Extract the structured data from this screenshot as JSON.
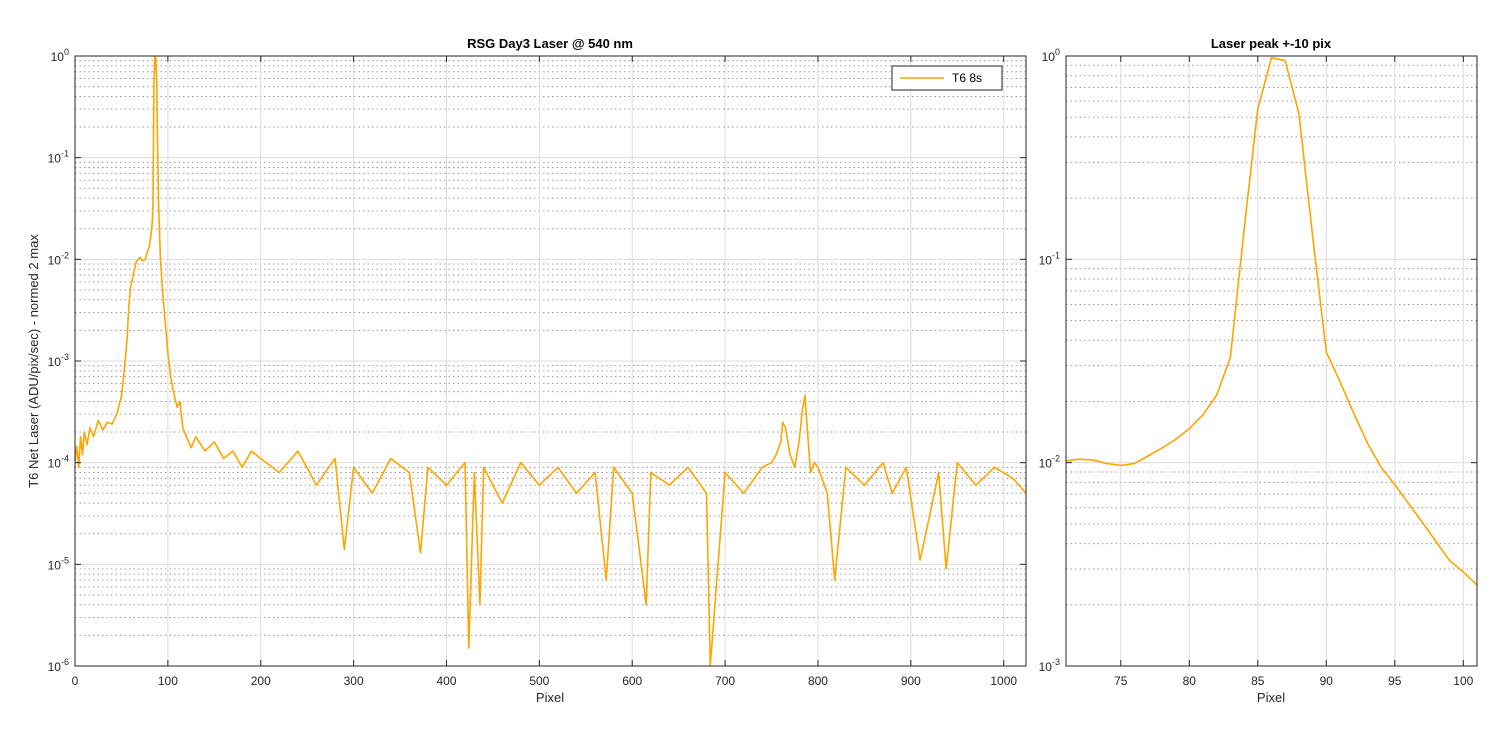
{
  "colors": {
    "series": "#ffa500",
    "grid_major": "#dcdcdc",
    "grid_minor": "#9a9a9a",
    "axis": "#262626",
    "background": "#ffffff"
  },
  "chart_data": [
    {
      "type": "line",
      "title": "RSG  Day3 Laser @ 540 nm",
      "xlabel": "Pixel",
      "ylabel": "T6 Net Laser (ADU/pix/sec) - normed 2 max",
      "xlim": [
        0,
        1024
      ],
      "ylim": [
        1e-06,
        1
      ],
      "yscale": "log",
      "grid": true,
      "legend_position": "top-right",
      "xticks": [
        0,
        100,
        200,
        300,
        400,
        500,
        600,
        700,
        800,
        900,
        1000
      ],
      "xtick_labels": [
        "0",
        "100",
        "200",
        "300",
        "400",
        "500",
        "600",
        "700",
        "800",
        "900",
        "1000"
      ],
      "yticks": [
        1e-06,
        1e-05,
        0.0001,
        0.001,
        0.01,
        0.1,
        1
      ],
      "ytick_labels": [
        {
          "base": "10",
          "exp": "-6"
        },
        {
          "base": "10",
          "exp": "-5"
        },
        {
          "base": "10",
          "exp": "-4"
        },
        {
          "base": "10",
          "exp": "-3"
        },
        {
          "base": "10",
          "exp": "-2"
        },
        {
          "base": "10",
          "exp": "-1"
        },
        {
          "base": "10",
          "exp": "0"
        }
      ],
      "series": [
        {
          "name": "T6 8s",
          "x": [
            0,
            2,
            4,
            6,
            8,
            10,
            13,
            16,
            20,
            25,
            30,
            35,
            40,
            45,
            50,
            53,
            56,
            58,
            60,
            62,
            64,
            66,
            68,
            70,
            72,
            74,
            76,
            78,
            80,
            82,
            83,
            84,
            85,
            86,
            87,
            88,
            89,
            90,
            92,
            95,
            98,
            100,
            103,
            106,
            110,
            113,
            116,
            120,
            125,
            130,
            140,
            150,
            160,
            170,
            180,
            190,
            200,
            220,
            240,
            260,
            280,
            290,
            300,
            320,
            340,
            360,
            372,
            380,
            400,
            420,
            424,
            430,
            436,
            440,
            460,
            480,
            500,
            520,
            540,
            560,
            572,
            580,
            600,
            615,
            620,
            640,
            660,
            680,
            684,
            700,
            720,
            740,
            750,
            755,
            760,
            762,
            765,
            770,
            775,
            780,
            783,
            786,
            788,
            792,
            796,
            800,
            810,
            818,
            830,
            850,
            870,
            880,
            895,
            910,
            930,
            938,
            950,
            970,
            990,
            1010,
            1024
          ],
          "y": [
            0.000105,
            0.000145,
            9e-05,
            0.00018,
            0.00012,
            0.0002,
            0.00015,
            0.00022,
            0.00018,
            0.00026,
            0.00021,
            0.00025,
            0.00024,
            0.0003,
            0.00045,
            0.0008,
            0.0016,
            0.0035,
            0.0055,
            0.0065,
            0.008,
            0.0095,
            0.01,
            0.0105,
            0.0098,
            0.0097,
            0.0102,
            0.0118,
            0.0135,
            0.018,
            0.022,
            0.035,
            0.55,
            1.0,
            0.95,
            0.55,
            0.12,
            0.035,
            0.01,
            0.004,
            0.002,
            0.0012,
            0.0007,
            0.0005,
            0.00035,
            0.0004,
            0.00022,
            0.00018,
            0.00014,
            0.00018,
            0.00013,
            0.00016,
            0.00011,
            0.00013,
            9e-05,
            0.00013,
            0.00011,
            8e-05,
            0.00013,
            6e-05,
            0.00011,
            1.4e-05,
            9e-05,
            5e-05,
            0.00011,
            8e-05,
            1.3e-05,
            9e-05,
            6e-05,
            0.0001,
            1.5e-06,
            8e-05,
            4e-06,
            9e-05,
            4e-05,
            0.0001,
            6e-05,
            9e-05,
            5e-05,
            8e-05,
            7e-06,
            9e-05,
            5e-05,
            4e-06,
            8e-05,
            6e-05,
            9e-05,
            5e-05,
            1e-06,
            8e-05,
            5e-05,
            9e-05,
            0.0001,
            0.00012,
            0.00016,
            0.00025,
            0.00022,
            0.00012,
            9e-05,
            0.00017,
            0.00032,
            0.00046,
            0.00025,
            8e-05,
            0.0001,
            9e-05,
            5e-05,
            7e-06,
            9e-05,
            6e-05,
            0.0001,
            5e-05,
            9e-05,
            1.1e-05,
            8e-05,
            9e-06,
            0.0001,
            6e-05,
            9e-05,
            7e-05,
            5e-05
          ]
        }
      ]
    },
    {
      "type": "line",
      "title": "Laser peak +-10 pix",
      "xlabel": "Pixel",
      "ylabel": "",
      "xlim": [
        71,
        101
      ],
      "ylim": [
        0.001,
        1
      ],
      "yscale": "log",
      "grid": true,
      "xticks": [
        75,
        80,
        85,
        90,
        95,
        100
      ],
      "xtick_labels": [
        "75",
        "80",
        "85",
        "90",
        "95",
        "100"
      ],
      "yticks": [
        0.001,
        0.01,
        0.1,
        1
      ],
      "ytick_labels": [
        {
          "base": "10",
          "exp": "-3"
        },
        {
          "base": "10",
          "exp": "-2"
        },
        {
          "base": "10",
          "exp": "-1"
        },
        {
          "base": "10",
          "exp": "0"
        }
      ],
      "series": [
        {
          "name": "T6 8s",
          "x": [
            71,
            72,
            73,
            74,
            75,
            76,
            77,
            78,
            79,
            80,
            81,
            82,
            83,
            84,
            85,
            86,
            87,
            88,
            89,
            90,
            91,
            92,
            93,
            94,
            95,
            96,
            97,
            98,
            99,
            100,
            101
          ],
          "y": [
            0.0102,
            0.0104,
            0.0103,
            0.0099,
            0.0097,
            0.0099,
            0.0108,
            0.0118,
            0.013,
            0.0147,
            0.0172,
            0.0215,
            0.033,
            0.14,
            0.55,
            0.98,
            0.95,
            0.52,
            0.13,
            0.035,
            0.025,
            0.0175,
            0.0125,
            0.0095,
            0.0078,
            0.0063,
            0.0051,
            0.0041,
            0.0033,
            0.0029,
            0.0025
          ]
        }
      ]
    }
  ]
}
